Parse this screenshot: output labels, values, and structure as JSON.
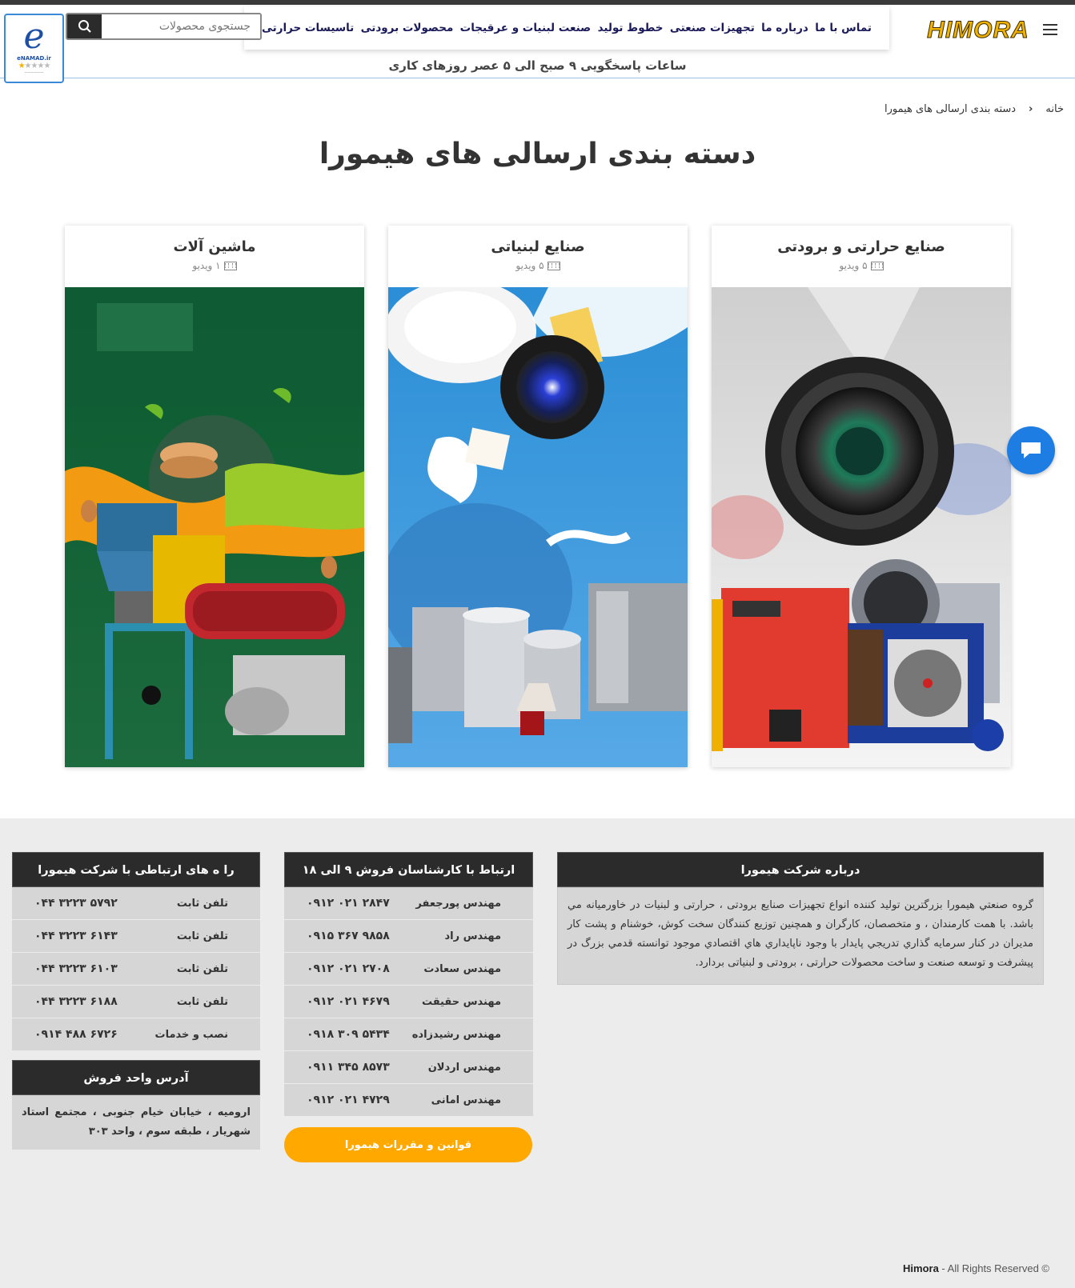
{
  "header": {
    "logo_text": "HIMORA",
    "nav": [
      "تاسیسات حرارتی",
      "محصولات برودتی",
      "صنعت لبنیات و عرقیجات",
      "خطوط تولید",
      "تجهیزات صنعتی",
      "درباره ما",
      "تماس با ما"
    ],
    "search_placeholder": "جستجوی محصولات",
    "enamad_site": "eNAMAD.ir",
    "working_hours": "ساعات پاسخگویی ۹ صبح الی ۵ عصر روزهای کاری"
  },
  "breadcrumb": {
    "home": "خانه",
    "current": "دسته بندی ارسالی های هیمورا"
  },
  "page_title": "دسته بندی ارسالی های هیمورا",
  "categories": [
    {
      "title": "صنایع حرارتی و برودتی",
      "count": "۵ ویدیو"
    },
    {
      "title": "صنایع لبنیاتی",
      "count": "۵ ویدیو"
    },
    {
      "title": "ماشین آلات",
      "count": "۱ ویدیو"
    }
  ],
  "footer": {
    "about": {
      "title": "درباره شرکت هیمورا",
      "text": "گروه صنعتي هيمورا بزرگترين توليد كننده انواع تجهیزات صنایع برودتی ، حرارتی و لبنیات در خاورمیانه مي باشد. با همت كارمندان ، و متخصصان، كارگران و همچنين توزيع كنندگان سخت كوش، خوشنام و پشت كار مديران در كنار سرمايه گذاري تدريجي پايدار با وجود ناپايداري هاي اقتصادي موجود توانسته قدمي بزرگ در پيشرفت و توسعه صنعت و ساخت محصولات حرارتی ، برودتی و لبنیاتی بردارد."
    },
    "sales": {
      "title": "ارتباط با کارشناسان فروش ۹ الی ۱۸",
      "rows": [
        {
          "name": "مهندس پورجعفر",
          "phone": "۰۹۱۲ ۰۲۱ ۲۸۴۷"
        },
        {
          "name": "مهندس راد",
          "phone": "۰۹۱۵ ۳۶۷ ۹۸۵۸"
        },
        {
          "name": "مهندس سعادت",
          "phone": "۰۹۱۲ ۰۲۱ ۲۷۰۸"
        },
        {
          "name": "مهندس حقیقت",
          "phone": "۰۹۱۲ ۰۲۱ ۴۶۷۹"
        },
        {
          "name": "مهندس رشیدزاده",
          "phone": "۰۹۱۸ ۳۰۹ ۵۴۳۴"
        },
        {
          "name": "مهندس اردلان",
          "phone": "۰۹۱۱ ۳۴۵ ۸۵۷۳"
        },
        {
          "name": "مهندس امانی",
          "phone": "۰۹۱۲ ۰۲۱ ۴۷۲۹"
        }
      ],
      "rules_button": "قوانین و مقررات هیمورا"
    },
    "contact": {
      "title": "را ه های ارتباطی با شرکت هیمورا",
      "rows": [
        {
          "label": "تلفن ثابت",
          "phone": "۰۴۴ ۳۲۲۳ ۵۷۹۲"
        },
        {
          "label": "تلفن ثابت",
          "phone": "۰۴۴ ۳۲۲۳ ۶۱۴۳"
        },
        {
          "label": "تلفن ثابت",
          "phone": "۰۴۴ ۳۲۲۳ ۶۱۰۳"
        },
        {
          "label": "تلفن ثابت",
          "phone": "۰۴۴ ۳۲۲۳ ۶۱۸۸"
        },
        {
          "label": "نصب و خدمات",
          "phone": "۰۹۱۴ ۴۸۸ ۶۷۲۶"
        }
      ]
    },
    "address": {
      "title": "آدرس واحد فروش",
      "text": "ارومیه ، خیابان خیام جنوبی ، مجتمع استاد شهریار ، طبقه سوم ، واحد ۳۰۳"
    },
    "copyright_brand": "Himora",
    "copyright_text": " - All Rights Reserved ©"
  },
  "colors": {
    "accent": "#ffa800",
    "chat": "#1e7de3",
    "footer_head": "#2b2b2b",
    "footer_bg": "#ececec"
  }
}
